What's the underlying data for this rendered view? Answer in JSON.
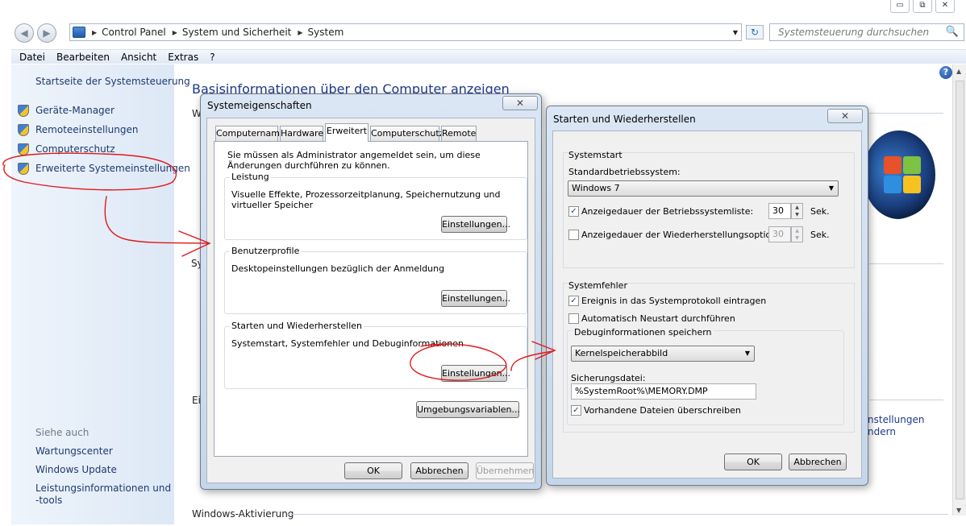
{
  "window_controls": [
    "▭",
    "⧉",
    "✕"
  ],
  "nav": {
    "back": "◀",
    "forward": "▶",
    "breadcrumb": [
      "Control Panel",
      "System und Sicherheit",
      "System"
    ],
    "search_placeholder": "Systemsteuerung durchsuchen"
  },
  "menu": [
    "Datei",
    "Bearbeiten",
    "Ansicht",
    "Extras",
    "?"
  ],
  "left_pane": {
    "home": "Startseite der Systemsteuerung",
    "links": [
      "Geräte-Manager",
      "Remoteeinstellungen",
      "Computerschutz",
      "Erweiterte Systemeinstellungen"
    ],
    "see_also_title": "Siehe auch",
    "see_also": [
      "Wartungscenter",
      "Windows Update",
      "Leistungsinformationen und",
      "-tools"
    ]
  },
  "main": {
    "title": "Basisinformationen über den Computer anzeigen",
    "frag_w": "W",
    "frag_sy": "Sy",
    "frag_ei": "Ei",
    "right_link1": "nstellungen",
    "right_link2": "ndern",
    "activation": "Windows-Aktivierung"
  },
  "sysprops": {
    "title": "Systemeigenschaften",
    "close": "✕",
    "tabs": [
      "Computername",
      "Hardware",
      "Erweitert",
      "Computerschutz",
      "Remote"
    ],
    "admin_note": "Sie müssen als Administrator angemeldet sein, um diese Änderungen durchführen zu können.",
    "leistung": {
      "title": "Leistung",
      "desc": "Visuelle Effekte, Prozessorzeitplanung, Speichernutzung und virtueller Speicher",
      "button": "Einstellungen..."
    },
    "profile": {
      "title": "Benutzerprofile",
      "desc": "Desktopeinstellungen bezüglich der Anmeldung",
      "button": "Einstellungen..."
    },
    "startup": {
      "title": "Starten und Wiederherstellen",
      "desc": "Systemstart, Systemfehler und Debuginformationen",
      "button": "Einstellungen..."
    },
    "env_button": "Umgebungsvariablen...",
    "ok": "OK",
    "cancel": "Abbrechen",
    "apply": "Übernehmen"
  },
  "startup_dialog": {
    "title": "Starten und Wiederherstellen",
    "close": "✕",
    "systemstart": {
      "title": "Systemstart",
      "default_os_label": "Standardbetriebssystem:",
      "default_os": "Windows 7",
      "os_list_label": "Anzeigedauer der Betriebssystemliste:",
      "os_list_value": "30",
      "os_list_checked": true,
      "recovery_label": "Anzeigedauer der Wiederherstellungsoptionen:",
      "recovery_value": "30",
      "recovery_checked": false,
      "unit": "Sek."
    },
    "systemfehler": {
      "title": "Systemfehler",
      "log_label": "Ereignis in das Systemprotokoll eintragen",
      "log_checked": true,
      "restart_label": "Automatisch Neustart durchführen",
      "restart_checked": false,
      "debug_title": "Debuginformationen speichern",
      "debug_type": "Kernelspeicherabbild",
      "dump_label": "Sicherungsdatei:",
      "dump_path": "%SystemRoot%\\MEMORY.DMP",
      "overwrite_label": "Vorhandene Dateien überschreiben",
      "overwrite_checked": true
    },
    "ok": "OK",
    "cancel": "Abbrechen"
  },
  "colors": {
    "link": "#1e3a6e",
    "title_blue": "#1e3a8a",
    "annotation": "#e0191b"
  },
  "check_mark": "✓",
  "icons": {
    "search": "🔍",
    "refresh": "↻",
    "help": "?",
    "dropdown": "▼",
    "separator": "▶"
  }
}
